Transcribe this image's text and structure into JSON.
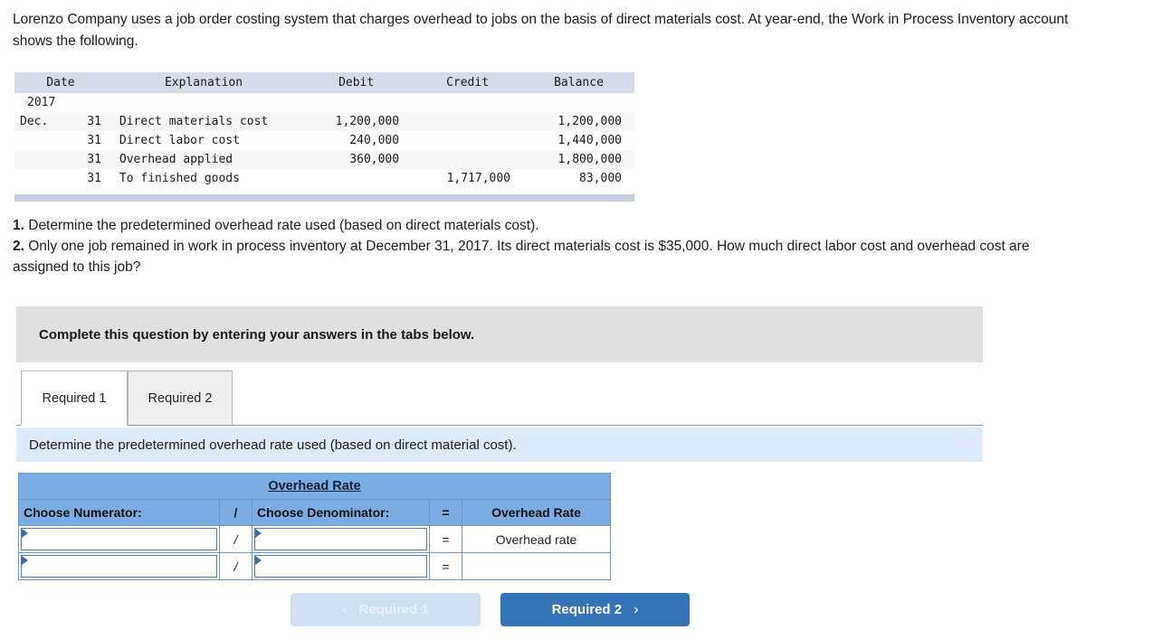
{
  "intro": {
    "paragraph": "Lorenzo Company uses a job order costing system that charges overhead to jobs on the basis of direct materials cost. At year-end, the Work in Process Inventory account shows the following."
  },
  "ledger": {
    "columns": [
      "Date",
      "Explanation",
      "Debit",
      "Credit",
      "Balance"
    ],
    "year_row": "2017",
    "rows": [
      {
        "month": "Dec.",
        "day": "31",
        "explanation": "Direct materials cost",
        "debit": "1,200,000",
        "credit": "",
        "balance": "1,200,000"
      },
      {
        "month": "",
        "day": "31",
        "explanation": "Direct labor cost",
        "debit": "240,000",
        "credit": "",
        "balance": "1,440,000"
      },
      {
        "month": "",
        "day": "31",
        "explanation": "Overhead applied",
        "debit": "360,000",
        "credit": "",
        "balance": "1,800,000"
      },
      {
        "month": "",
        "day": "31",
        "explanation": "To finished goods",
        "debit": "",
        "credit": "1,717,000",
        "balance": "83,000"
      }
    ]
  },
  "requirements": {
    "num1": "1.",
    "text1": " Determine the predetermined overhead rate used (based on direct materials cost).",
    "num2": "2.",
    "text2": " Only one job remained in work in process inventory at December 31, 2017. Its direct materials cost is $35,000. How much direct labor cost and overhead cost are assigned to this job?"
  },
  "banner": {
    "text": "Complete this question by entering your answers in the tabs below."
  },
  "tabs": [
    {
      "label": "Required 1",
      "active": true
    },
    {
      "label": "Required 2",
      "active": false
    }
  ],
  "instruction": {
    "text": "Determine the predetermined overhead rate used (based on direct material cost)."
  },
  "overhead_table": {
    "title": "Overhead Rate",
    "headers": {
      "numerator": "Choose Numerator:",
      "slash": "/",
      "denominator": "Choose Denominator:",
      "equals": "=",
      "rate": "Overhead Rate"
    },
    "rows": [
      {
        "numerator": "",
        "slash": "/",
        "denominator": "",
        "equals": "=",
        "rate": "Overhead rate"
      },
      {
        "numerator": "",
        "slash": "/",
        "denominator": "",
        "equals": "=",
        "rate": ""
      }
    ]
  },
  "nav": {
    "prev_label": "Required 1",
    "prev_chevron": "‹",
    "next_label": "Required 2",
    "next_chevron": "›"
  },
  "colors": {
    "header_blue": "#7cace4",
    "instruction_blue": "#dceafa",
    "banner_gray": "#e0e0e0",
    "ledger_header": "#d5dce8",
    "button_blue": "#3374b6",
    "button_disabled": "#cfe0f1"
  }
}
